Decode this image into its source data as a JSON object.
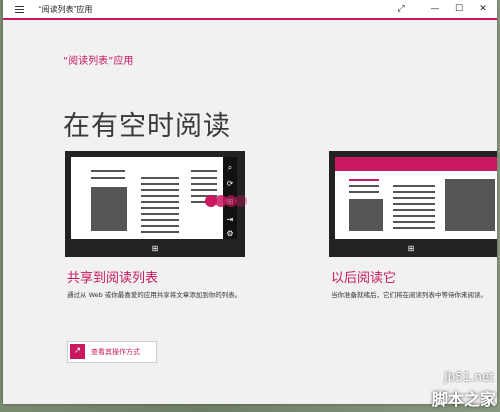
{
  "window": {
    "title": "“阅读列表”应用",
    "accent_color": "#c9185f"
  },
  "titlebar_icons": {
    "menu": "hamburger-icon",
    "expand": "expand-icon",
    "minimize": "minimize-icon",
    "maximize": "maximize-icon",
    "close": "close-icon"
  },
  "glyphs": {
    "expand": "⤢",
    "minimize": "—",
    "maximize": "☐",
    "close": "✕",
    "arrow": "↗",
    "win": "⊞",
    "search": "⌕",
    "share": "⟳",
    "start": "⊞",
    "devices": "⇥",
    "settings": "⚙"
  },
  "main": {
    "app_heading": "“阅读列表”应用",
    "tagline": "在有空时阅读",
    "cards": [
      {
        "title": "共享到阅读列表",
        "description": "通过从 Web 或你最喜爱的应用共享将文章添加到你的列表。",
        "action_label": "查看其操作方式"
      },
      {
        "title": "以后阅读它",
        "description": "当你准备就绪后，它们将在阅读列表中等待你来阅读。"
      }
    ]
  },
  "watermark": {
    "site": "jb51.net",
    "name": "脚本之家"
  }
}
